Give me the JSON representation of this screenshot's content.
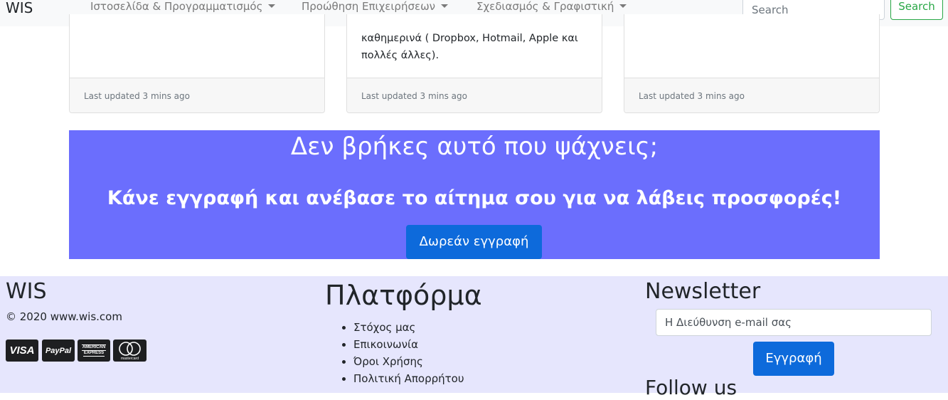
{
  "navbar": {
    "brand": "WIS",
    "items": [
      {
        "label": "Ιστοσελίδα & Προγραμματισμός"
      },
      {
        "label": "Προώθηση Επιχειρήσεων"
      },
      {
        "label": "Σχεδιασμός & Γραφιστική"
      }
    ],
    "search_placeholder": "Search",
    "search_button": "Search"
  },
  "cards": [
    {
      "text": "",
      "footer": "Last updated 3 mins ago"
    },
    {
      "text": "καθημερινά ( Dropbox, Hotmail, Apple και πολλές άλλες).",
      "footer": "Last updated 3 mins ago"
    },
    {
      "text": "",
      "footer": "Last updated 3 mins ago"
    }
  ],
  "banner": {
    "title": "Δεν βρήκες αυτό που ψάχνεις;",
    "subtitle": "Κάνε εγγραφή και ανέβασε το αίτημα σου για να λάβεις προσφορές!",
    "button": "Δωρεάν εγγραφή",
    "color": "#6b6efd"
  },
  "footer": {
    "brand": "WIS",
    "copyright": "© 2020 www.wis.com",
    "payment_icons": [
      "visa-icon",
      "paypal-icon",
      "american-express-icon",
      "mastercard-icon"
    ],
    "payment_labels": {
      "visa": "VISA",
      "paypal": "PayPal",
      "amex_line1": "AMERICAN",
      "amex_line2": "EXPRESS",
      "mastercard": "mastercard"
    },
    "platform_title": "Πλατφόρμα",
    "platform_links": [
      "Στόχος μας",
      "Επικοινωνία",
      "Όροι Χρήσης",
      "Πολιτική Απορρήτου"
    ],
    "newsletter_title": "Newsletter",
    "newsletter_placeholder": "Η Διεύθυνση e-mail σας",
    "newsletter_button": "Εγγραφή",
    "follow_title": "Follow us",
    "background": "#e6e6fd"
  }
}
